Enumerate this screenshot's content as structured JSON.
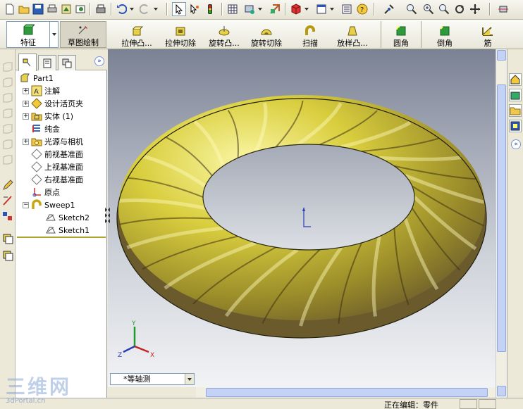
{
  "command_manager": {
    "buttons": [
      {
        "label": "特征"
      },
      {
        "label": "草图绘制"
      },
      {
        "label": "拉伸凸..."
      },
      {
        "label": "拉伸切除"
      },
      {
        "label": "旋转凸..."
      },
      {
        "label": "旋转切除"
      },
      {
        "label": "扫描"
      },
      {
        "label": "放样凸..."
      },
      {
        "label": "圆角"
      },
      {
        "label": "倒角"
      },
      {
        "label": "筋"
      }
    ]
  },
  "feature_tree": {
    "root": "Part1",
    "items": [
      {
        "label": "注解",
        "icon": "annotation-icon",
        "expandable": true
      },
      {
        "label": "设计活页夹",
        "icon": "design-binder-icon",
        "expandable": true
      },
      {
        "label": "实体 (1)",
        "icon": "solid-body-icon",
        "expandable": true
      },
      {
        "label": "纯金",
        "icon": "material-icon",
        "expandable": false
      },
      {
        "label": "光源与相机",
        "icon": "lights-camera-icon",
        "expandable": true
      },
      {
        "label": "前视基准面",
        "icon": "plane-icon",
        "expandable": false
      },
      {
        "label": "上视基准面",
        "icon": "plane-icon",
        "expandable": false
      },
      {
        "label": "右视基准面",
        "icon": "plane-icon",
        "expandable": false
      },
      {
        "label": "原点",
        "icon": "origin-icon",
        "expandable": false
      },
      {
        "label": "Sweep1",
        "icon": "sweep-icon",
        "expandable": true,
        "expanded": true
      },
      {
        "label": "Sketch2",
        "icon": "sketch-icon",
        "expandable": false,
        "child": true
      },
      {
        "label": "Sketch1",
        "icon": "sketch-icon",
        "expandable": false,
        "child": true
      }
    ]
  },
  "viewport": {
    "view_orientation": "*等轴测",
    "triad_labels": {
      "x": "X",
      "y": "Y",
      "z": "Z"
    }
  },
  "status_bar": {
    "text": "正在编辑：零件"
  },
  "watermark": {
    "big": "三维网",
    "small": "3dPortal.cn"
  },
  "colors": {
    "gold": "#c9c036",
    "gold_dark": "#6b5a2c",
    "viewport_top": "#7b8294",
    "viewport_bottom": "#f2f3f5"
  }
}
